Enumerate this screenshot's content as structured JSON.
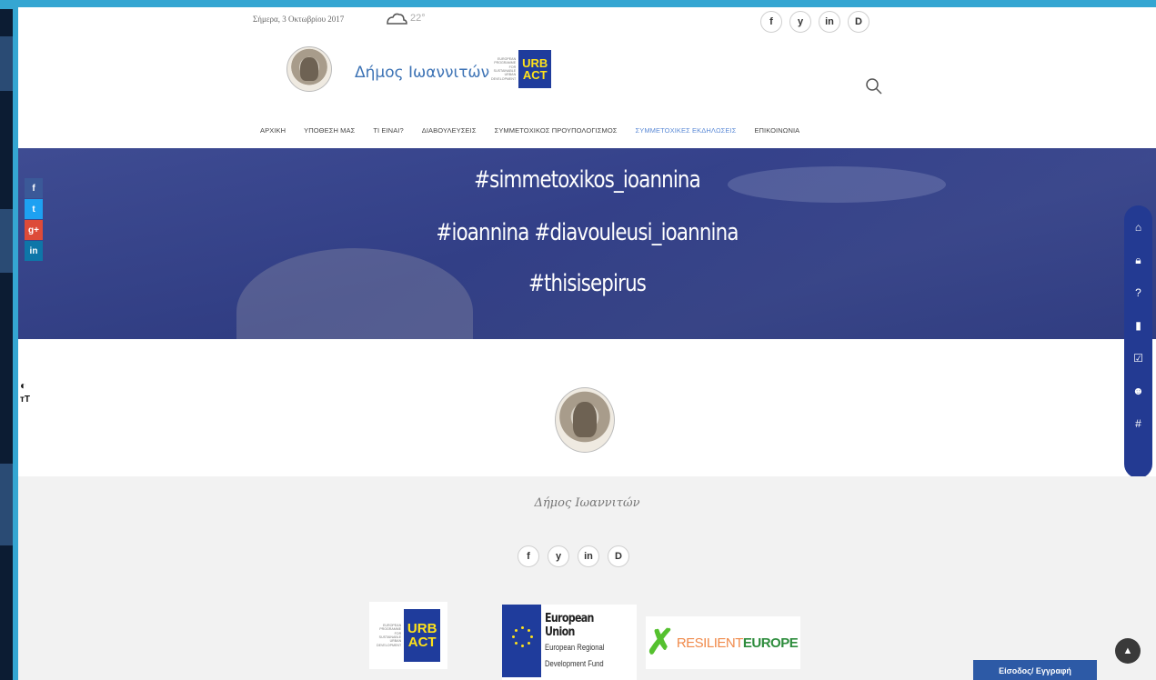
{
  "topbar": {
    "date": "Σήμερα, 3 Οκτωβρίου 2017",
    "temperature": "22°",
    "social": [
      "f",
      "y",
      "in",
      "D"
    ]
  },
  "header": {
    "site_title": "Δήμος Ιωαννιτών",
    "urbact_text": [
      "EUROPEAN",
      "PROGRAMME",
      "FOR",
      "SUSTAINABLE",
      "URBAN",
      "DEVELOPMENT"
    ],
    "urbact_line1": "URB",
    "urbact_line2": "ACT",
    "search_icon": "search-icon"
  },
  "nav": {
    "items": [
      {
        "label": "ΑΡΧΙΚΗ"
      },
      {
        "label": "ΥΠΟΘΕΣΗ ΜΑΣ"
      },
      {
        "label": "ΤΙ ΕΙΝΑΙ?"
      },
      {
        "label": "ΔΙΑΒΟΥΛΕΥΣΕΙΣ"
      },
      {
        "label": "ΣΥΜΜΕΤΟΧΙΚΟΣ ΠΡΟΥΠΟΛΟΓΙΣΜΟΣ"
      },
      {
        "label": "ΣΥΜΜΕΤΟΧΙΚΕΣ ΕΚΔΗΛΩΣΕΙΣ"
      },
      {
        "label": "ΕΠΙΚΟΙΝΩΝΙΑ"
      }
    ],
    "active_index": 5
  },
  "hero": {
    "line1": "#simmetoxikos_ioannina",
    "line2": "#ioannina #diavouleusi_ioannina",
    "line3": "#thisisepirus"
  },
  "share": [
    {
      "label": "f",
      "color": "#3b5998"
    },
    {
      "label": "t",
      "color": "#1da1f2"
    },
    {
      "label": "g+",
      "color": "#dd4b39"
    },
    {
      "label": "in",
      "color": "#0e76a8"
    }
  ],
  "side_rail_icons": [
    "home-icon",
    "lock-icon",
    "question-icon",
    "book-icon",
    "checkbox-icon",
    "users-icon",
    "hashtag-icon"
  ],
  "accessibility": {
    "contrast": "◐",
    "textsize": "тT"
  },
  "footer": {
    "title": "Δήμος Ιωαννιτών",
    "social": [
      "f",
      "y",
      "in",
      "D"
    ],
    "eu_title": "European Union",
    "eu_line1": "European Regional",
    "eu_line2": "Development Fund",
    "resilient_a": "RESILIENT",
    "resilient_b": "EUROPE",
    "login_label": "Είσοδος/ Εγγραφή"
  },
  "colors": {
    "accent": "#3d73b5",
    "hero": "#2e3a82",
    "rail": "#233a92",
    "frame": "#35a6d2"
  }
}
